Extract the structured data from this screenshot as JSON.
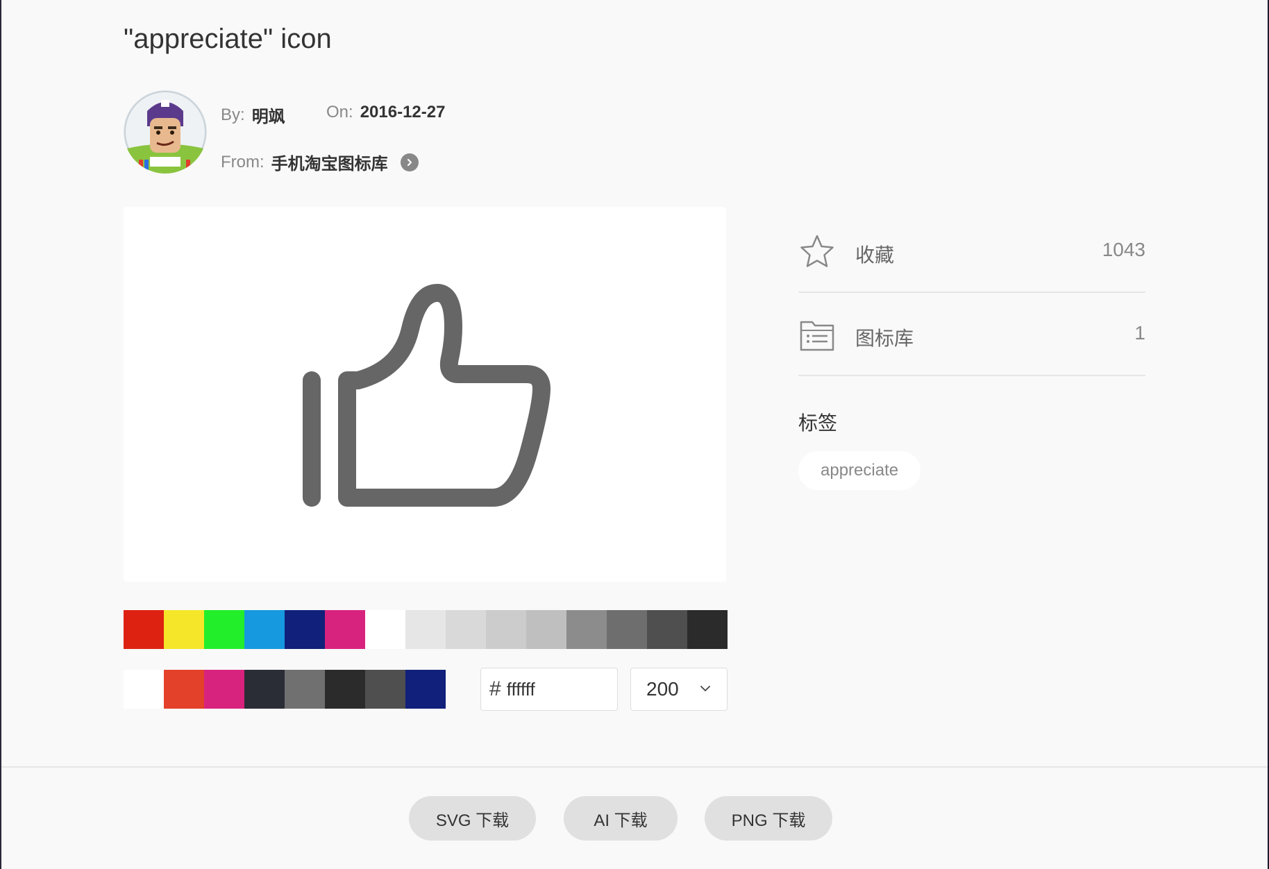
{
  "page": {
    "title": "\"appreciate\" icon"
  },
  "meta": {
    "by_label": "By:",
    "author": "明飒",
    "on_label": "On:",
    "date": "2016-12-27",
    "from_label": "From:",
    "library": "手机淘宝图标库"
  },
  "stats": {
    "collect_label": "收藏",
    "collect_count": "1043",
    "library_label": "图标库",
    "library_count": "1"
  },
  "tags": {
    "title": "标签",
    "items": [
      "appreciate"
    ]
  },
  "palette_main": [
    "#dd2211",
    "#f5e62a",
    "#22ee2a",
    "#1699de",
    "#11207a",
    "#d8237e",
    "#ffffff",
    "#e6e6e6",
    "#d9d9d9",
    "#cccccc",
    "#bfbfbf",
    "#8c8c8c",
    "#6e6e6e",
    "#4f4f4f",
    "#2b2b2b"
  ],
  "palette_recent": [
    "#ffffff",
    "#e34129",
    "#d8237e",
    "#2b2d36",
    "#707070",
    "#2b2b2b",
    "#4f4f4f",
    "#11207a"
  ],
  "color_input": {
    "hash": "#",
    "value": "ffffff"
  },
  "size_select": {
    "value": "200"
  },
  "icon_color": "#666666",
  "downloads": {
    "svg": "SVG 下载",
    "ai": "AI 下载",
    "png": "PNG 下载"
  }
}
